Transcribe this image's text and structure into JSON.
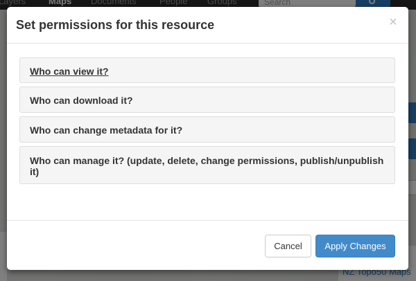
{
  "background": {
    "nav": [
      "Layers",
      "Maps",
      "Documents",
      "People",
      "Groups"
    ],
    "active_nav": "Maps",
    "search_placeholder": "Search",
    "card_text": "NZ Topo50 Maps"
  },
  "modal": {
    "title": "Set permissions for this resource",
    "close_symbol": "×",
    "panels": [
      {
        "label": "Who can view it?"
      },
      {
        "label": "Who can download it?"
      },
      {
        "label": "Who can change metadata for it?"
      },
      {
        "label": "Who can manage it? (update, delete, change permissions, publish/unpublish it)"
      }
    ],
    "footer": {
      "cancel_label": "Cancel",
      "apply_label": "Apply Changes"
    }
  },
  "colors": {
    "primary": "#428bca",
    "topbar": "#2c2c2c"
  }
}
